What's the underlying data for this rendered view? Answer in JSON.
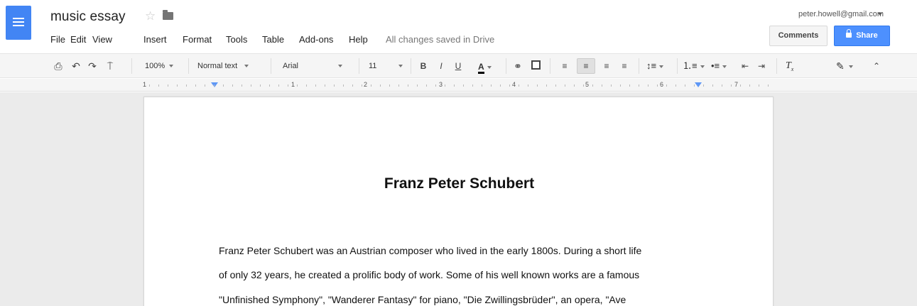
{
  "doc": {
    "title": "music essay",
    "saved_status": "All changes saved in Drive"
  },
  "menu": [
    "File",
    "Edit",
    "View",
    "Insert",
    "Format",
    "Tools",
    "Table",
    "Add-ons",
    "Help"
  ],
  "user": {
    "email": "peter.howell@gmail.com"
  },
  "buttons": {
    "comments": "Comments",
    "share": "Share"
  },
  "toolbar": {
    "zoom": "100%",
    "style": "Normal text",
    "font": "Arial",
    "font_size": "11",
    "bold": "B",
    "italic": "I",
    "underline": "U",
    "text_color": "A"
  },
  "ruler": {
    "numbers": [
      "1",
      "1",
      "2",
      "3",
      "4",
      "5",
      "6",
      "7"
    ]
  },
  "content": {
    "heading": "Franz Peter Schubert",
    "lines": [
      "Franz Peter Schubert was an Austrian composer who lived in the early 1800s. During a short life",
      "of only 32 years, he created a prolific body of work. Some of his well known works are a famous",
      "\"Unfinished Symphony\", \"Wanderer Fantasy\" for piano, \"Die Zwillingsbrüder\", an opera, \"Ave"
    ]
  },
  "colors": {
    "brand_blue": "#4285f4",
    "share_blue": "#4d90fe",
    "toolbar_bg": "#f5f5f5",
    "canvas_bg": "#ebebeb"
  },
  "icons": [
    "docs-logo-icon",
    "star-icon",
    "folder-icon",
    "print-icon",
    "undo-icon",
    "redo-icon",
    "paint-format-icon",
    "link-icon",
    "comment-icon",
    "align-left-icon",
    "align-center-icon",
    "align-right-icon",
    "align-justify-icon",
    "line-spacing-icon",
    "numbered-list-icon",
    "bulleted-list-icon",
    "decrease-indent-icon",
    "increase-indent-icon",
    "clear-formatting-icon",
    "pen-icon",
    "collapse-icon",
    "lock-icon"
  ]
}
